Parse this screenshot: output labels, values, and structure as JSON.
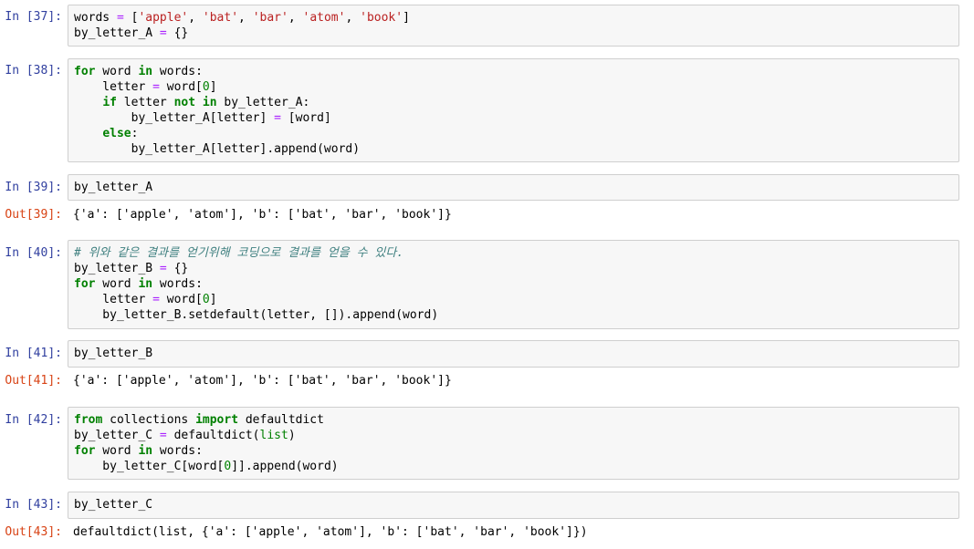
{
  "cells": [
    {
      "prompt": "In [37]:",
      "lines": [
        [
          [
            "t",
            "words "
          ],
          [
            "op",
            "="
          ],
          [
            "t",
            " ["
          ],
          [
            "str",
            "'apple'"
          ],
          [
            "t",
            ", "
          ],
          [
            "str",
            "'bat'"
          ],
          [
            "t",
            ", "
          ],
          [
            "str",
            "'bar'"
          ],
          [
            "t",
            ", "
          ],
          [
            "str",
            "'atom'"
          ],
          [
            "t",
            ", "
          ],
          [
            "str",
            "'book'"
          ],
          [
            "t",
            "]"
          ]
        ],
        [
          [
            "t",
            "by_letter_A "
          ],
          [
            "op",
            "="
          ],
          [
            "t",
            " {}"
          ]
        ]
      ]
    },
    {
      "prompt": "In [38]:",
      "lines": [
        [
          [
            "kw",
            "for"
          ],
          [
            "t",
            " word "
          ],
          [
            "kw",
            "in"
          ],
          [
            "t",
            " words:"
          ]
        ],
        [
          [
            "t",
            "    letter "
          ],
          [
            "op",
            "="
          ],
          [
            "t",
            " word["
          ],
          [
            "num",
            "0"
          ],
          [
            "t",
            "]"
          ]
        ],
        [
          [
            "t",
            "    "
          ],
          [
            "kw",
            "if"
          ],
          [
            "t",
            " letter "
          ],
          [
            "kw",
            "not"
          ],
          [
            "t",
            " "
          ],
          [
            "kw",
            "in"
          ],
          [
            "t",
            " by_letter_A:"
          ]
        ],
        [
          [
            "t",
            "        by_letter_A[letter] "
          ],
          [
            "op",
            "="
          ],
          [
            "t",
            " [word]"
          ]
        ],
        [
          [
            "t",
            "    "
          ],
          [
            "kw",
            "else"
          ],
          [
            "t",
            ":"
          ]
        ],
        [
          [
            "t",
            "        by_letter_A[letter].append(word)"
          ]
        ]
      ]
    },
    {
      "prompt": "In [39]:",
      "lines": [
        [
          [
            "t",
            "by_letter_A"
          ]
        ]
      ],
      "out_prompt": "Out[39]:",
      "output": "{'a': ['apple', 'atom'], 'b': ['bat', 'bar', 'book']}"
    },
    {
      "prompt": "In [40]:",
      "lines": [
        [
          [
            "cm",
            "# 위와 같은 결과를 얻기위해 코딩으로 결과를 얻을 수 있다."
          ]
        ],
        [
          [
            "t",
            "by_letter_B "
          ],
          [
            "op",
            "="
          ],
          [
            "t",
            " {}"
          ]
        ],
        [
          [
            "kw",
            "for"
          ],
          [
            "t",
            " word "
          ],
          [
            "kw",
            "in"
          ],
          [
            "t",
            " words:"
          ]
        ],
        [
          [
            "t",
            "    letter "
          ],
          [
            "op",
            "="
          ],
          [
            "t",
            " word["
          ],
          [
            "num",
            "0"
          ],
          [
            "t",
            "]"
          ]
        ],
        [
          [
            "t",
            "    by_letter_B.setdefault(letter, []).append(word)"
          ]
        ]
      ]
    },
    {
      "prompt": "In [41]:",
      "lines": [
        [
          [
            "t",
            "by_letter_B"
          ]
        ]
      ],
      "out_prompt": "Out[41]:",
      "output": "{'a': ['apple', 'atom'], 'b': ['bat', 'bar', 'book']}"
    },
    {
      "prompt": "In [42]:",
      "lines": [
        [
          [
            "kw",
            "from"
          ],
          [
            "t",
            " collections "
          ],
          [
            "kw",
            "import"
          ],
          [
            "t",
            " defaultdict"
          ]
        ],
        [
          [
            "t",
            "by_letter_C "
          ],
          [
            "op",
            "="
          ],
          [
            "t",
            " defaultdict("
          ],
          [
            "bi",
            "list"
          ],
          [
            "t",
            ")"
          ]
        ],
        [
          [
            "kw",
            "for"
          ],
          [
            "t",
            " word "
          ],
          [
            "kw",
            "in"
          ],
          [
            "t",
            " words:"
          ]
        ],
        [
          [
            "t",
            "    by_letter_C[word["
          ],
          [
            "num",
            "0"
          ],
          [
            "t",
            "]].append(word)"
          ]
        ]
      ]
    },
    {
      "prompt": "In [43]:",
      "lines": [
        [
          [
            "t",
            "by_letter_C"
          ]
        ]
      ],
      "out_prompt": "Out[43]:",
      "output": "defaultdict(list, {'a': ['apple', 'atom'], 'b': ['bat', 'bar', 'book']})"
    }
  ],
  "colors": {
    "in_prompt": "#303f9f",
    "out_prompt": "#d84315",
    "keyword": "#008000",
    "operator": "#aa22ff",
    "string": "#ba2121",
    "comment": "#408080",
    "cell_background": "#f7f7f7",
    "cell_border": "#cfcfcf"
  }
}
